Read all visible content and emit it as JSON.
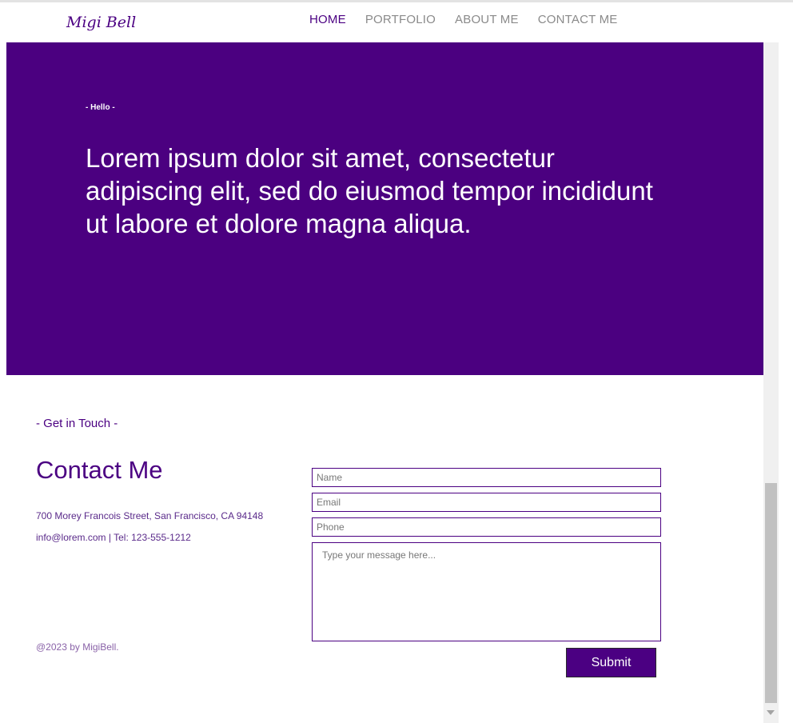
{
  "header": {
    "logo": "Migi Bell",
    "nav": [
      {
        "label": "HOME",
        "active": true
      },
      {
        "label": "PORTFOLIO",
        "active": false
      },
      {
        "label": "ABOUT ME",
        "active": false
      },
      {
        "label": "CONTACT ME",
        "active": false
      }
    ]
  },
  "hero": {
    "kicker": "- Hello -",
    "text": "Lorem ipsum dolor sit amet, consectetur adipiscing elit, sed do eiusmod tempor incididunt ut labore et dolore magna aliqua."
  },
  "contact": {
    "kicker": "- Get in Touch -",
    "title": "Contact Me",
    "address": "700 Morey Francois Street, San Francisco, CA 94148",
    "contact_line": "info@lorem.com | Tel: 123-555-1212",
    "copyright": "@2023 by MigiBell."
  },
  "form": {
    "name_placeholder": "Name",
    "email_placeholder": "Email",
    "phone_placeholder": "Phone",
    "message_placeholder": "Type your message here...",
    "submit_label": "Submit"
  },
  "colors": {
    "brand": "#4b0082",
    "hero_bg": "#4b0080",
    "nav_inactive": "#8a8a8a"
  }
}
